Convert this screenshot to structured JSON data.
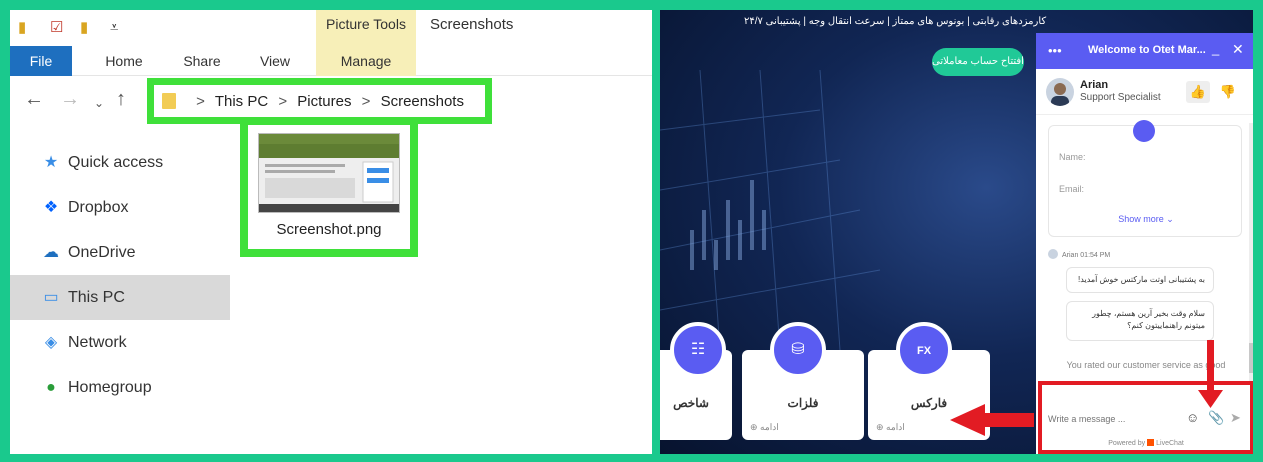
{
  "explorer": {
    "title_bar": {
      "context_tab_group": "Picture Tools",
      "window_title": "Screenshots"
    },
    "ribbon_tabs": [
      "File",
      "Home",
      "Share",
      "View",
      "Manage"
    ],
    "breadcrumb": [
      "This PC",
      "Pictures",
      "Screenshots"
    ],
    "sidebar": [
      {
        "label": "Quick access",
        "icon": "star-icon"
      },
      {
        "label": "Dropbox",
        "icon": "dropbox-icon"
      },
      {
        "label": "OneDrive",
        "icon": "cloud-icon"
      },
      {
        "label": "This PC",
        "icon": "computer-icon",
        "selected": true
      },
      {
        "label": "Network",
        "icon": "network-icon"
      },
      {
        "label": "Homegroup",
        "icon": "homegroup-icon"
      }
    ],
    "file": {
      "name": "Screenshot.png"
    }
  },
  "website": {
    "top_text": "کارمزدهای رقابتی | بونوس های ممتاز | سرعت انتقال وجه | پشتیبانی ۲۴/۷",
    "open_account": "افتتاح حساب معاملاتی",
    "cards": [
      {
        "title": "شاخص"
      },
      {
        "title": "فلزات",
        "more": "ادامه"
      },
      {
        "title": "فارکس",
        "more": "ادامه",
        "icon_text": "FX"
      }
    ]
  },
  "chat": {
    "header_title": "Welcome to Otet Mar...",
    "agent": {
      "name": "Arian",
      "role": "Support Specialist"
    },
    "form": {
      "name_label": "Name:",
      "email_label": "Email:",
      "show_more": "Show more ⌄"
    },
    "message_meta": "Arian 01:54 PM",
    "messages": [
      "به پشتیبانی اوتت مارکتس خوش آمدید!",
      "سلام وقت بخیر آرین هستم، چطور میتونم راهنماییتون کنم؟"
    ],
    "rated_text": "You rated our customer service as good",
    "input_placeholder": "Write a message ...",
    "powered_by_prefix": "Powered by",
    "powered_by_brand": "LiveChat"
  },
  "colors": {
    "highlight_green": "#3fe03a",
    "highlight_red": "#e21b23",
    "chat_accent": "#5a5cf2",
    "background_frame": "#1ac98d",
    "file_tab": "#1e6fbf"
  }
}
